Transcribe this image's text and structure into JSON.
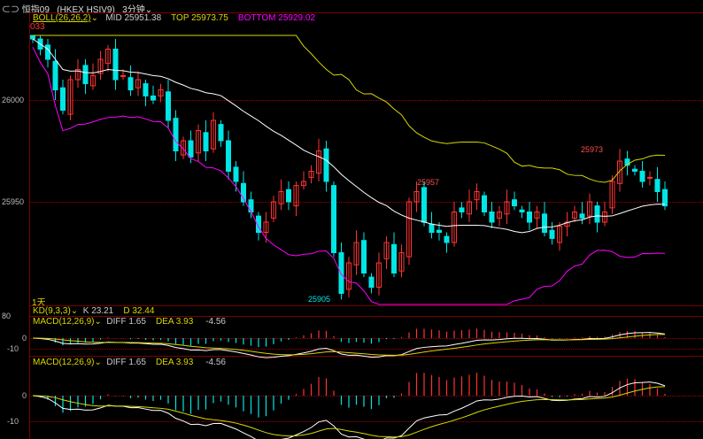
{
  "header": {
    "link_icon": "link-icon",
    "symbol": "恒指09",
    "code": "(HKEX HSIV9)",
    "period": "3分钟"
  },
  "boll": {
    "label": "BOLL(26,26,2)",
    "mid": "MID 25951.38",
    "top": "TOP 25973.75",
    "bottom": "BOTTOM 25929.02"
  },
  "price_axis": {
    "a": "26000",
    "b": "25950"
  },
  "annotations": {
    "left_high": "033",
    "low": "25905",
    "mid_high": "25957",
    "right_high": "25973",
    "range": "1天"
  },
  "kd": {
    "label": "KD(9,3,3)",
    "k": "K 23.21",
    "d": "D 32.44",
    "axis": "80"
  },
  "macd1": {
    "label": "MACD(12,26,9)",
    "diff": "DIFF 1.65",
    "dea": "DEA 3.93",
    "macd": "-4.56",
    "zero": "0",
    "neg": "-10"
  },
  "macd2": {
    "label": "MACD(12,26,9)",
    "diff": "DIFF 1.65",
    "dea": "DEA 3.93",
    "macd": "-4.56",
    "zero": "0",
    "neg": "-10"
  },
  "colors": {
    "up": "#ff3232",
    "down": "#00e5e5",
    "mid": "#ffffff",
    "top": "#d8d800",
    "bottom": "#ff00ff"
  },
  "chart_data": {
    "type": "candlestick",
    "price_range": [
      25895,
      26035
    ],
    "close": [
      26030,
      26025,
      26020,
      26005,
      25995,
      26010,
      26015,
      26008,
      26012,
      26020,
      26025,
      26010,
      26012,
      26005,
      26010,
      26002,
      26000,
      26005,
      25990,
      25975,
      25980,
      25972,
      25985,
      25975,
      25990,
      25980,
      25965,
      25960,
      25950,
      25945,
      25935,
      25940,
      25950,
      25955,
      25950,
      25958,
      25960,
      25965,
      25975,
      25960,
      25925,
      25905,
      25920,
      25930,
      25915,
      25908,
      25920,
      25930,
      25915,
      25925,
      25950,
      25955,
      25940,
      25935,
      25935,
      25930,
      25945,
      25945,
      25950,
      25955,
      25945,
      25940,
      25945,
      25950,
      25948,
      25945,
      25940,
      25945,
      25935,
      25932,
      25938,
      25940,
      25945,
      25942,
      25950,
      25940,
      25945,
      25960,
      25970,
      25968,
      25965,
      25960,
      25962,
      25955,
      25948
    ]
  }
}
